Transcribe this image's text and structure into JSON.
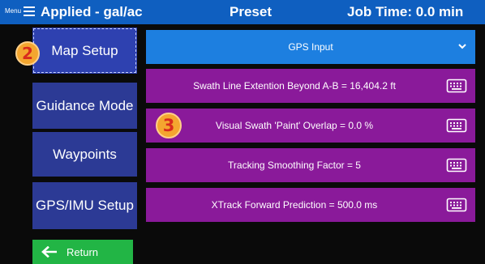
{
  "topbar": {
    "menu_label": "Menu",
    "menu_icon": "hamburger-icon",
    "applied_label": "Applied - gal/ac",
    "preset_label": "Preset",
    "job_time_label": "Job Time: 0.0 min"
  },
  "sidebar": {
    "items": [
      {
        "label": "Map Setup",
        "badge": "2",
        "selected": true
      },
      {
        "label": "Guidance Mode"
      },
      {
        "label": "Waypoints"
      },
      {
        "label": "GPS/IMU Setup"
      }
    ],
    "scroll_fraction_visible": 0.76,
    "return": {
      "label": "Return",
      "icon": "left-arrow-icon"
    }
  },
  "section": {
    "header": "GPS Input",
    "header_icon": "chevron-down-icon",
    "rows": [
      {
        "text": "Swath Line Extention Beyond A-B = 16,404.2 ft",
        "icon": "keyboard-icon"
      },
      {
        "text": "Visual Swath 'Paint' Overlap = 0.0 %",
        "icon": "keyboard-icon",
        "badge": "3"
      },
      {
        "text": "Tracking Smoothing Factor = 5",
        "icon": "keyboard-icon"
      },
      {
        "text": "XTrack Forward Prediction = 500.0 ms",
        "icon": "keyboard-icon"
      }
    ]
  },
  "colors": {
    "topbar": "#0f5fc0",
    "nav_button": "#2c3a95",
    "section_header": "#1d7fe0",
    "row": "#8a1a9a",
    "return_button": "#22b545",
    "badge": "#f4a62f",
    "badge_text": "#d92b1d"
  }
}
